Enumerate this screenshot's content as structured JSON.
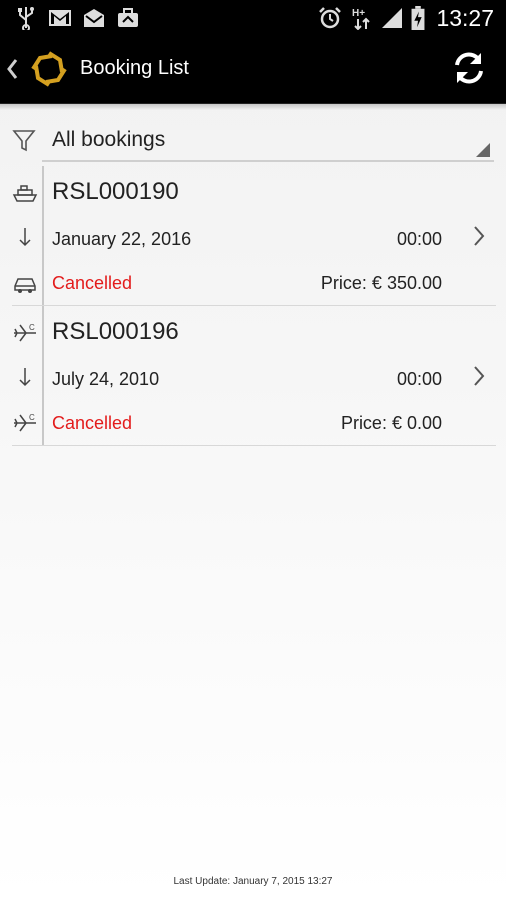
{
  "status_bar": {
    "time": "13:27",
    "icons": [
      "usb-icon",
      "gmail-icon",
      "email-icon",
      "briefcase-icon",
      "alarm-icon",
      "hspa-icon",
      "signal-icon",
      "battery-charging-icon"
    ]
  },
  "action_bar": {
    "title": "Booking List",
    "icons": [
      "back-chevron-icon",
      "app-logo-icon",
      "refresh-icon"
    ]
  },
  "filter": {
    "selected": "All bookings",
    "icon": "filter-funnel-icon"
  },
  "bookings": [
    {
      "reference": "RSL000190",
      "date": "January 22, 2016",
      "time": "00:00",
      "status": "Cancelled",
      "price": "Price: € 350.00",
      "icons": [
        "ship-icon",
        "arrow-down-icon",
        "car-icon"
      ]
    },
    {
      "reference": "RSL000196",
      "date": "July 24, 2010",
      "time": "00:00",
      "status": "Cancelled",
      "price": "Price: € 0.00",
      "icons": [
        "airplane-icon",
        "arrow-down-icon",
        "airplane-icon"
      ]
    }
  ],
  "footer": {
    "last_update": "Last Update: January 7, 2015 13:27"
  },
  "colors": {
    "cancelled": "#e31b1b",
    "bar": "#000000",
    "logo_gold": "#d4a020"
  }
}
